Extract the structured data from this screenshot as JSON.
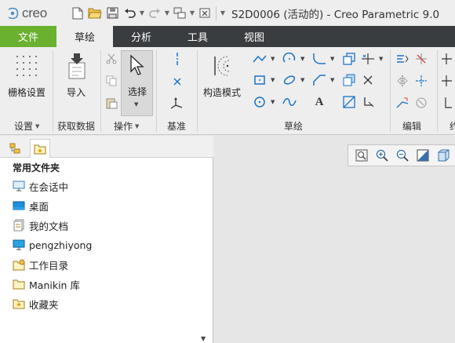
{
  "app": {
    "logo_text": "creo",
    "window_title": "S2D0006 (活动的) - Creo Parametric 9.0"
  },
  "tabs": [
    {
      "label": "文件"
    },
    {
      "label": "草绘"
    },
    {
      "label": "分析"
    },
    {
      "label": "工具"
    },
    {
      "label": "视图"
    }
  ],
  "ribbon": {
    "groups": {
      "settings": "设置",
      "get_data": "获取数据",
      "operations": "操作",
      "datum": "基准",
      "sketching": "草绘",
      "editing": "编辑",
      "constrain_partial": "约"
    },
    "buttons": {
      "grid_settings": "栅格设置",
      "import": "导入",
      "select": "选择",
      "construction_mode": "构造模式",
      "text_glyph": "A"
    }
  },
  "navigator": {
    "heading": "常用文件夹",
    "items": [
      {
        "label": "在会话中",
        "icon": "monitor-icon"
      },
      {
        "label": "桌面",
        "icon": "desktop-icon"
      },
      {
        "label": "我的文档",
        "icon": "documents-icon"
      },
      {
        "label": "pengzhiyong",
        "icon": "user-monitor-icon"
      },
      {
        "label": "工作目录",
        "icon": "work-folder-icon"
      },
      {
        "label": "Manikin 库",
        "icon": "library-folder-icon"
      },
      {
        "label": "收藏夹",
        "icon": "favorites-icon"
      }
    ]
  },
  "colors": {
    "file_tab": "#6ab130",
    "tab_bar": "#3a3d40",
    "icon_blue": "#1a73c8"
  }
}
